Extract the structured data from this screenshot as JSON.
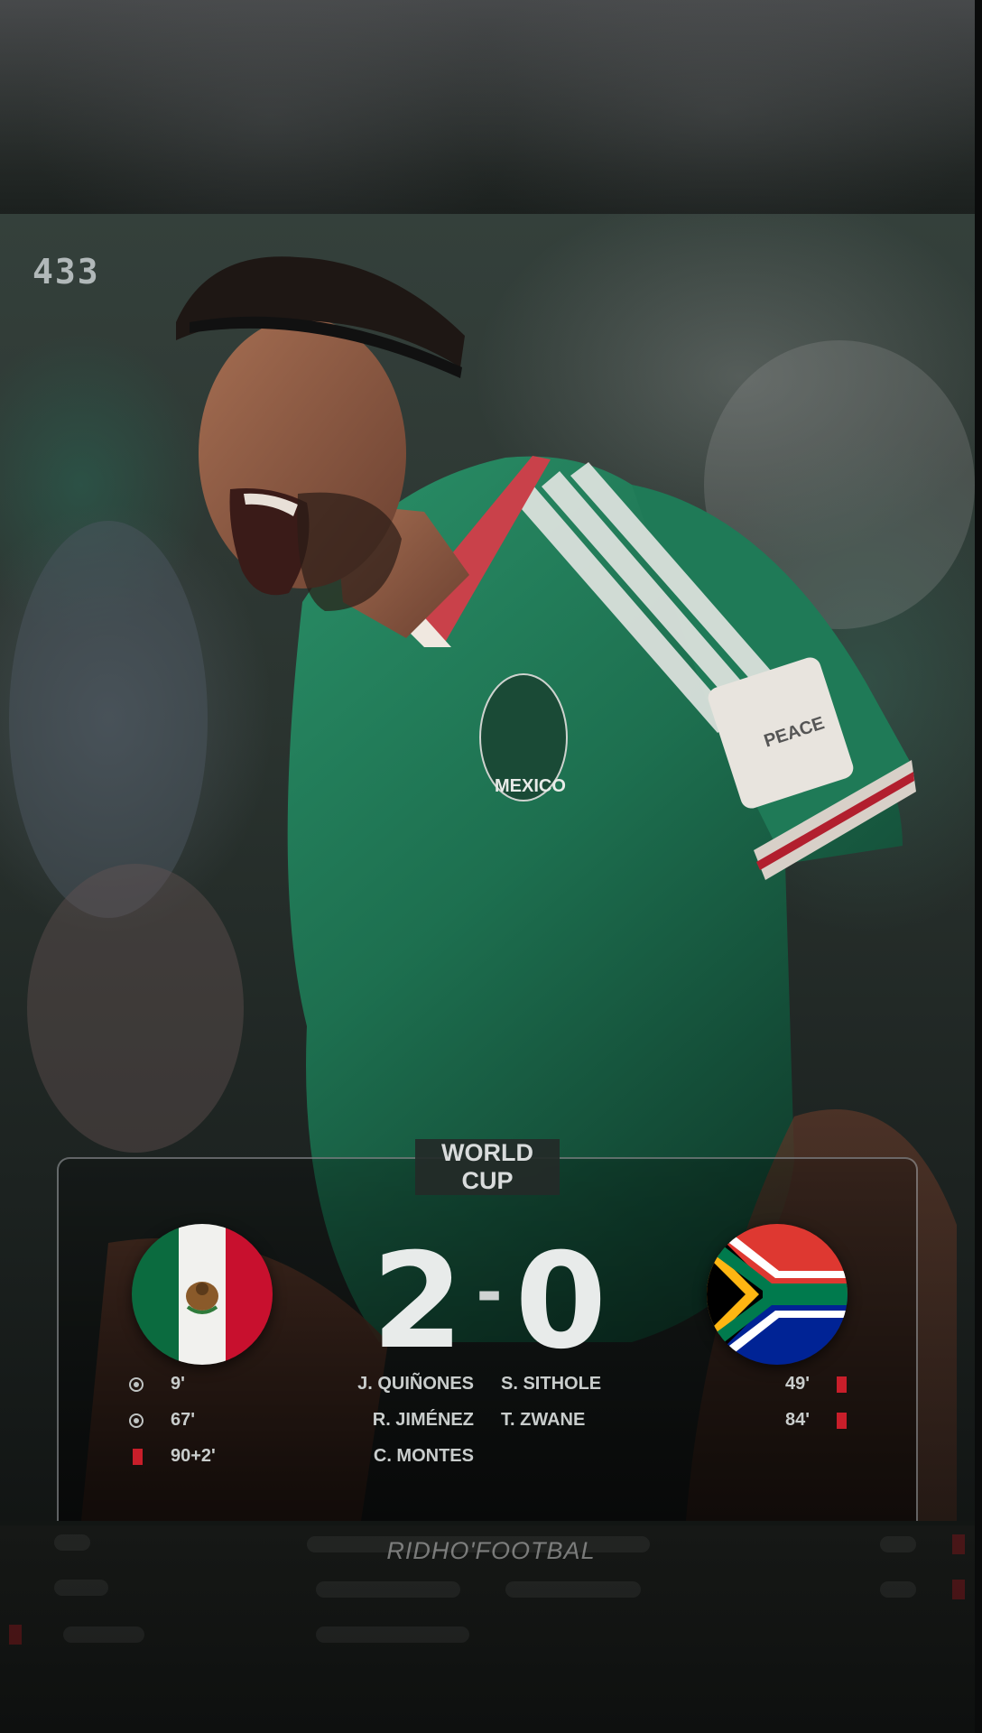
{
  "brand": {
    "logo_text": "433"
  },
  "competition": {
    "line1": "WORLD",
    "line2": "CUP"
  },
  "match": {
    "home_flag": "mexico-flag",
    "away_flag": "south-africa-flag",
    "home_score": "2",
    "separator": "-",
    "away_score": "0"
  },
  "events": {
    "home": [
      {
        "icon": "goal-ball-icon",
        "minute": "9'",
        "player": "J. QUIÑONES"
      },
      {
        "icon": "goal-ball-icon",
        "minute": "67'",
        "player": "R. JIMÉNEZ"
      },
      {
        "icon": "red-card-icon",
        "minute": "90+2'",
        "player": "C. MONTES"
      }
    ],
    "away": [
      {
        "icon": "red-card-icon",
        "minute": "49'",
        "player": "S. SITHOLE"
      },
      {
        "icon": "red-card-icon",
        "minute": "84'",
        "player": "T. ZWANE"
      }
    ]
  },
  "watermark": "RIDHO'FOOTBAL",
  "colors": {
    "jersey_green": "#1f7a55",
    "red_card": "#c81e2a",
    "mexico_green": "#0b6b3f",
    "mexico_red": "#c8102e",
    "sa_green": "#007a4d",
    "sa_red": "#de3831",
    "sa_blue": "#002395",
    "sa_gold": "#ffb612"
  }
}
